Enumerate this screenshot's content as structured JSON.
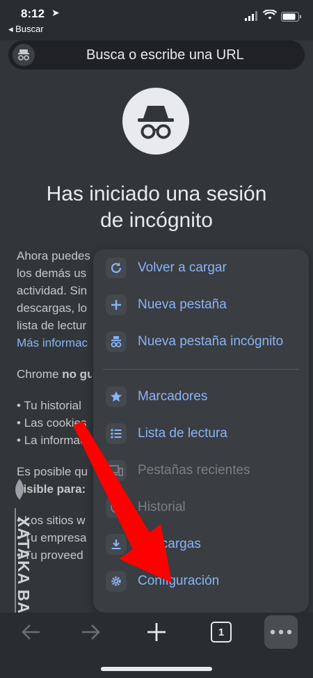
{
  "status_bar": {
    "time": "8:12",
    "back_label": "◂ Buscar"
  },
  "url_bar": {
    "placeholder": "Busca o escribe una URL"
  },
  "incognito": {
    "title_line1": "Has iniciado una sesión",
    "title_line2": "de incógnito",
    "body": [
      "Ahora puedes",
      "los demás us",
      "actividad. Sin",
      "descargas, lo",
      "lista de lectur"
    ],
    "link": "Más informac",
    "chrome_line_a": "Chrome ",
    "chrome_line_b": "no gu",
    "bullets": [
      "Tu historial",
      "Las cookies",
      "La informac"
    ],
    "posible_a": "Es posible qu",
    "posible_b": "visible para:",
    "sites": [
      "Los sitios w",
      "Tu empresa",
      "Tu proveed"
    ]
  },
  "menu": {
    "items": [
      {
        "label": "Volver a cargar",
        "icon": "reload-icon",
        "enabled": true
      },
      {
        "label": "Nueva pestaña",
        "icon": "plus-icon",
        "enabled": true
      },
      {
        "label": "Nueva pestaña incógnito",
        "icon": "incognito-icon",
        "enabled": true
      },
      {
        "label": "Marcadores",
        "icon": "star-icon",
        "enabled": true
      },
      {
        "label": "Lista de lectura",
        "icon": "list-icon",
        "enabled": true
      },
      {
        "label": "Pestañas recientes",
        "icon": "devices-icon",
        "enabled": false
      },
      {
        "label": "Historial",
        "icon": "history-icon",
        "enabled": false
      },
      {
        "label": "Descargas",
        "icon": "download-icon",
        "enabled": true
      },
      {
        "label": "Configuración",
        "icon": "gear-icon",
        "enabled": true
      }
    ]
  },
  "toolbar": {
    "tab_count": "1"
  },
  "watermark": {
    "text": "XATAKA BASICS"
  },
  "colors": {
    "accent": "#8ab4f8",
    "background": "#323639",
    "menu": "#3a3d41",
    "arrow": "#ff0000"
  }
}
